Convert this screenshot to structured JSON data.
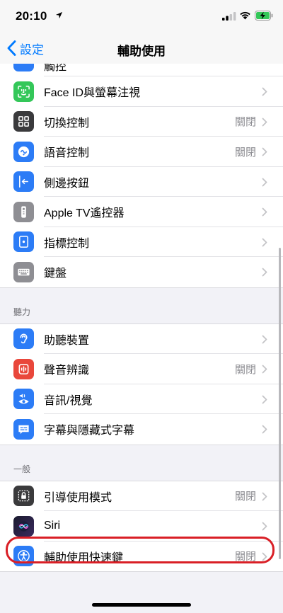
{
  "status_bar": {
    "time": "20:10"
  },
  "nav": {
    "back_label": "設定",
    "title": "輔助使用"
  },
  "partial_top": {
    "label": "觸控"
  },
  "groups": [
    {
      "header": "",
      "items": [
        {
          "label": "Face ID與螢幕注視",
          "value": "",
          "icon": "face-id-icon",
          "color": "#34c759"
        },
        {
          "label": "切換控制",
          "value": "關閉",
          "icon": "switch-control-icon",
          "color": "#3a3a3c"
        },
        {
          "label": "語音控制",
          "value": "關閉",
          "icon": "voice-control-icon",
          "color": "#2c7cf6"
        },
        {
          "label": "側邊按鈕",
          "value": "",
          "icon": "side-button-icon",
          "color": "#2c7cf6"
        },
        {
          "label": "Apple TV遙控器",
          "value": "",
          "icon": "apple-tv-remote-icon",
          "color": "#8e8e93"
        },
        {
          "label": "指標控制",
          "value": "",
          "icon": "pointer-control-icon",
          "color": "#2c7cf6"
        },
        {
          "label": "鍵盤",
          "value": "",
          "icon": "keyboard-icon",
          "color": "#8e8e93"
        }
      ]
    },
    {
      "header": "聽力",
      "items": [
        {
          "label": "助聽裝置",
          "value": "",
          "icon": "hearing-device-icon",
          "color": "#2c7cf6"
        },
        {
          "label": "聲音辨識",
          "value": "關閉",
          "icon": "sound-recognition-icon",
          "color": "#e9473b"
        },
        {
          "label": "音訊/視覺",
          "value": "",
          "icon": "audio-visual-icon",
          "color": "#2c7cf6"
        },
        {
          "label": "字幕與隱藏式字幕",
          "value": "",
          "icon": "subtitles-icon",
          "color": "#2c7cf6"
        }
      ]
    },
    {
      "header": "一般",
      "items": [
        {
          "label": "引導使用模式",
          "value": "關閉",
          "icon": "guided-access-icon",
          "color": "#3a3a3c"
        },
        {
          "label": "Siri",
          "value": "",
          "icon": "siri-icon",
          "color": "#1c1c2e"
        },
        {
          "label": "輔助使用快速鍵",
          "value": "關閉",
          "icon": "accessibility-shortcut-icon",
          "color": "#2c7cf6"
        }
      ]
    }
  ]
}
